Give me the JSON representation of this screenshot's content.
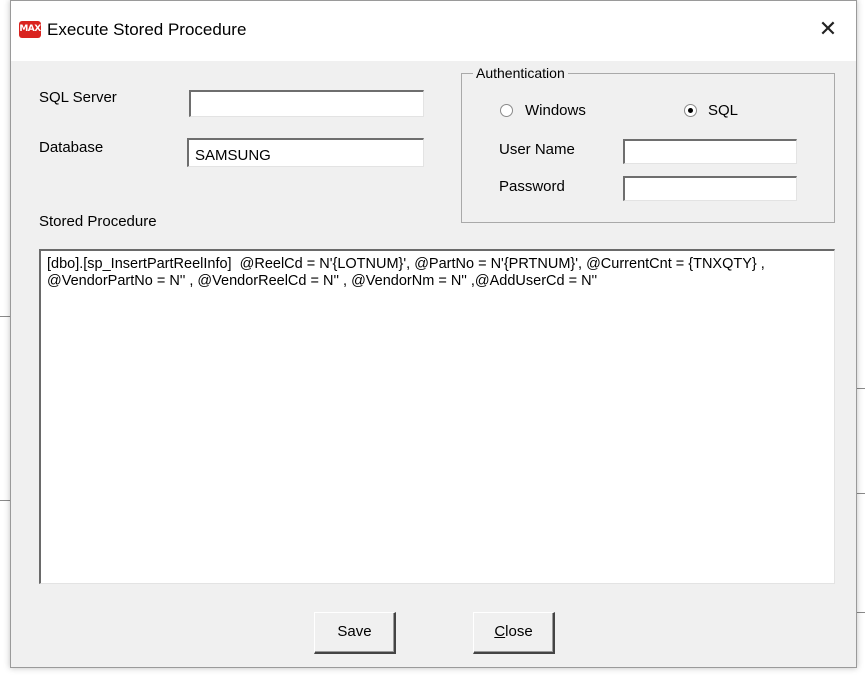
{
  "window": {
    "title": "Execute Stored Procedure",
    "icon_text": "MAX",
    "close_glyph": "✕"
  },
  "form": {
    "sql_server_label": "SQL Server",
    "sql_server_value": "",
    "database_label": "Database",
    "database_value": "SAMSUNG",
    "stored_procedure_label": "Stored Procedure",
    "stored_procedure_value": "[dbo].[sp_InsertPartReelInfo]  @ReelCd = N'{LOTNUM}', @PartNo = N'{PRTNUM}', @CurrentCnt = {TNXQTY} ,  @VendorPartNo = N'' , @VendorReelCd = N'' , @VendorNm = N'' ,@AddUserCd = N''"
  },
  "authentication": {
    "group_label": "Authentication",
    "windows_label": "Windows",
    "sql_label": "SQL",
    "selected": "SQL",
    "username_label": "User Name",
    "username_value": "",
    "password_label": "Password",
    "password_value": ""
  },
  "buttons": {
    "save_label": "Save",
    "close_mnemonic": "C",
    "close_rest": "lose"
  },
  "colors": {
    "icon_red": "#d9231f",
    "dialog_bg": "#f0f0f0"
  }
}
